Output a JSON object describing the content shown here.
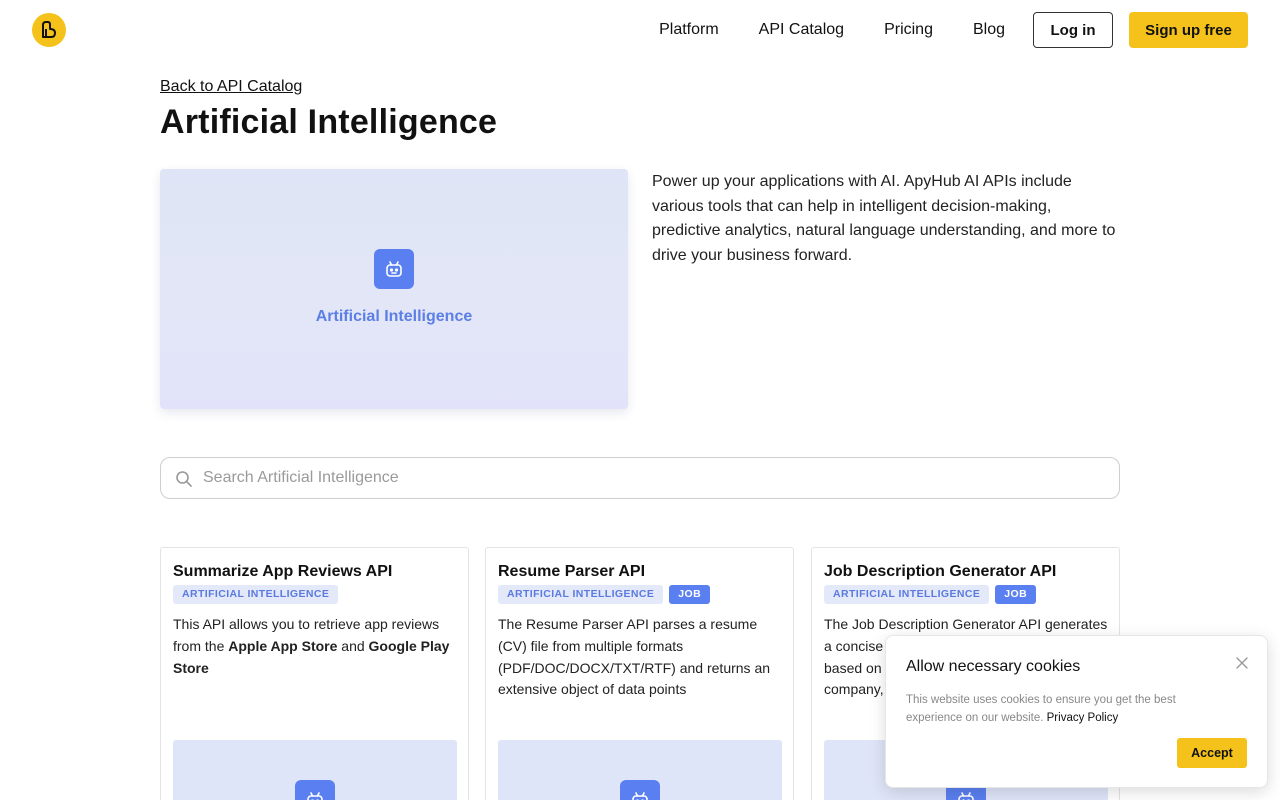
{
  "header": {
    "logo_icon": "apyhub-logo-icon",
    "nav": [
      {
        "label": "Platform"
      },
      {
        "label": "API Catalog"
      },
      {
        "label": "Pricing"
      },
      {
        "label": "Blog"
      }
    ],
    "login_label": "Log in",
    "signup_label": "Sign up free"
  },
  "main": {
    "back_link": "Back to API Catalog",
    "title": "Artificial Intelligence",
    "hero": {
      "icon": "robot-icon",
      "label": "Artificial Intelligence"
    },
    "description": "Power up your applications with AI. ApyHub AI APIs include various tools that can help in intelligent decision-making, predictive analytics, natural language understanding, and more to drive your business forward.",
    "search": {
      "placeholder": "Search Artificial Intelligence",
      "value": ""
    },
    "cards": [
      {
        "title": "Summarize App Reviews API",
        "tags": [
          "ARTIFICIAL INTELLIGENCE"
        ],
        "desc_parts": [
          {
            "text": "This API allows you to retrieve app reviews from the "
          },
          {
            "text": "Apple App Store",
            "bold": true
          },
          {
            "text": " and "
          },
          {
            "text": "Google Play Store",
            "bold": true
          }
        ]
      },
      {
        "title": "Resume Parser API",
        "tags": [
          "ARTIFICIAL INTELLIGENCE",
          "JOB"
        ],
        "desc_parts": [
          {
            "text": "The Resume Parser API parses a resume (CV) file from multiple formats (PDF/DOC/DOCX/TXT/RTF) and returns an extensive object of data points"
          }
        ]
      },
      {
        "title": "Job Description Generator API",
        "tags": [
          "ARTIFICIAL INTELLIGENCE",
          "JOB"
        ],
        "desc_parts": [
          {
            "text": "The Job Description Generator API generates a concise "
          },
          {
            "text": "based on "
          },
          {
            "text": "company, "
          }
        ]
      }
    ]
  },
  "cookie_banner": {
    "title": "Allow necessary cookies",
    "text": "This website uses cookies to ensure you get the best experience on our website. ",
    "link": "Privacy Policy",
    "accept_label": "Accept"
  },
  "colors": {
    "brand_yellow": "#f5c21b",
    "accent_blue": "#5a7ff0",
    "tag_bg": "#e4e9fa"
  }
}
